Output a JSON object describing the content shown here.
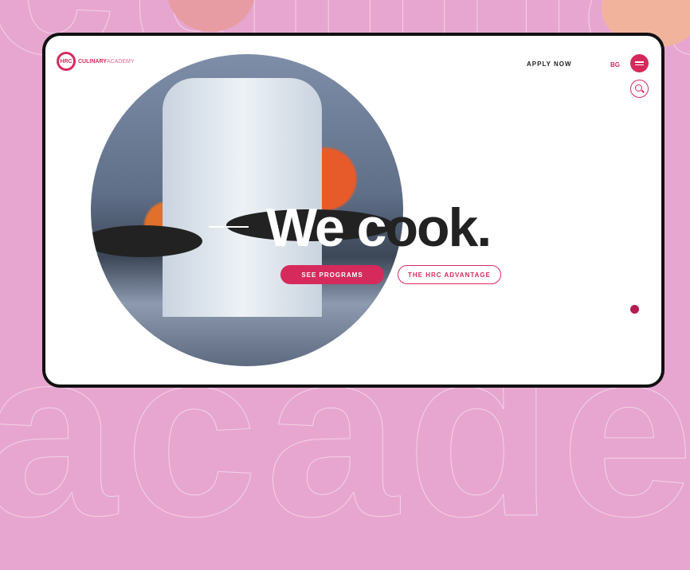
{
  "header": {
    "logo_mark": "HRC",
    "logo_name_bold": "CULINARY",
    "logo_name_light": "ACADEMY",
    "apply_label": "APPLY NOW",
    "lang_label": "BG"
  },
  "hero": {
    "headline_part1": "We c",
    "headline_part2": "ook.",
    "primary_button": "SEE PROGRAMS",
    "secondary_button": "THE HRC ADVANTAGE"
  },
  "colors": {
    "accent": "#d62a5c",
    "background": "#e7a6cf"
  }
}
